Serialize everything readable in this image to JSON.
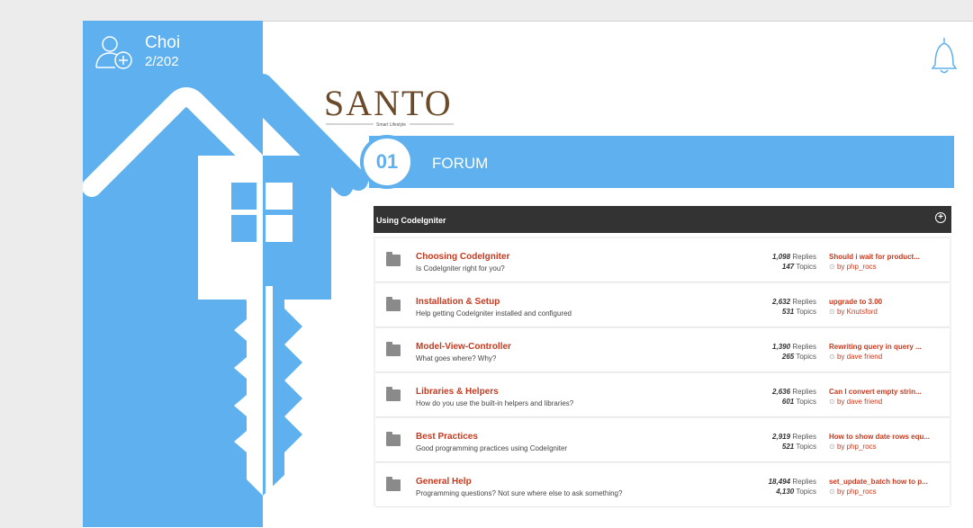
{
  "user": {
    "name": "Choi",
    "count": "2/202"
  },
  "logo": {
    "text": "SANTO",
    "tagline": "Smart Lifestyle"
  },
  "forum": {
    "number": "01",
    "title": "FORUM"
  },
  "category": {
    "title": "Using CodeIgniter"
  },
  "rows": [
    {
      "title": "Choosing CodeIgniter",
      "desc": "Is CodeIgniter right for you?",
      "replies": "1,098",
      "replies_label": "Replies",
      "topics": "147",
      "topics_label": "Topics",
      "last_title": "Should i wait for product...",
      "last_by": "by php_rocs"
    },
    {
      "title": "Installation & Setup",
      "desc": "Help getting CodeIgniter installed and configured",
      "replies": "2,632",
      "replies_label": "Replies",
      "topics": "531",
      "topics_label": "Topics",
      "last_title": "upgrade to 3.00",
      "last_by": "by Knutsford"
    },
    {
      "title": "Model-View-Controller",
      "desc": "What goes where? Why?",
      "replies": "1,390",
      "replies_label": "Replies",
      "topics": "265",
      "topics_label": "Topics",
      "last_title": "Rewriting query in query ...",
      "last_by": "by dave friend"
    },
    {
      "title": "Libraries & Helpers",
      "desc": "How do you use the built-in helpers and libraries?",
      "replies": "2,636",
      "replies_label": "Replies",
      "topics": "601",
      "topics_label": "Topics",
      "last_title": "Can I convert empty strin...",
      "last_by": "by dave friend"
    },
    {
      "title": "Best Practices",
      "desc": "Good programming practices using CodeIgniter",
      "replies": "2,919",
      "replies_label": "Replies",
      "topics": "521",
      "topics_label": "Topics",
      "last_title": "How to show date rows equ...",
      "last_by": "by php_rocs"
    },
    {
      "title": "General Help",
      "desc": "Programming questions? Not sure where else to ask something?",
      "replies": "18,494",
      "replies_label": "Replies",
      "topics": "4,130",
      "topics_label": "Topics",
      "last_title": "set_update_batch how to p...",
      "last_by": "by php_rocs"
    }
  ],
  "colors": {
    "accent": "#5eb0ee",
    "link": "#c63a1f",
    "header": "#333333"
  },
  "icons": {
    "user": "add-user-icon",
    "bell": "bell-icon",
    "folder": "folder-icon",
    "plus": "plus-circle-icon",
    "clock": "clock-icon"
  }
}
